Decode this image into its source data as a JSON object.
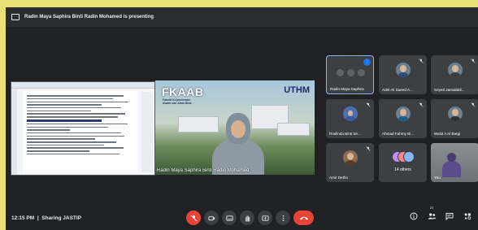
{
  "presenting_banner": {
    "text": "Radin Maya Saphira Binti Radin Mohamed is presenting"
  },
  "main_speaker": {
    "logo_text": "FKAAB",
    "sub_logo": "Fakulti Kejuruteraan Awam dan Alam Bina",
    "university_logo": "UTHM",
    "name": "Radin Maya Saphira Binti Radin Mohamed"
  },
  "tiles": [
    {
      "name": "Radin Maya Saphira",
      "kind": "controls",
      "speaking": true
    },
    {
      "name": "Adel Ali Saeed A...",
      "kind": "avatar"
    },
    {
      "name": "Seyed Jamalaldi...",
      "kind": "avatar"
    },
    {
      "name": "Roslinda Binti Se...",
      "kind": "avatar-hijab"
    },
    {
      "name": "Ahmad Fahmy Bi...",
      "kind": "avatar"
    },
    {
      "name": "Walid A Al Bargi",
      "kind": "avatar"
    },
    {
      "name": "Amir Detho",
      "kind": "avatar"
    },
    {
      "name": "14 others",
      "kind": "others"
    },
    {
      "name": "You",
      "kind": "you"
    }
  ],
  "bottom_bar": {
    "time": "12:15 PM",
    "separator": "|",
    "meeting_code": "Sharing JASTIP",
    "participant_count": "23",
    "accent_red": "#ea4335",
    "accent_blue": "#1a73e8"
  }
}
